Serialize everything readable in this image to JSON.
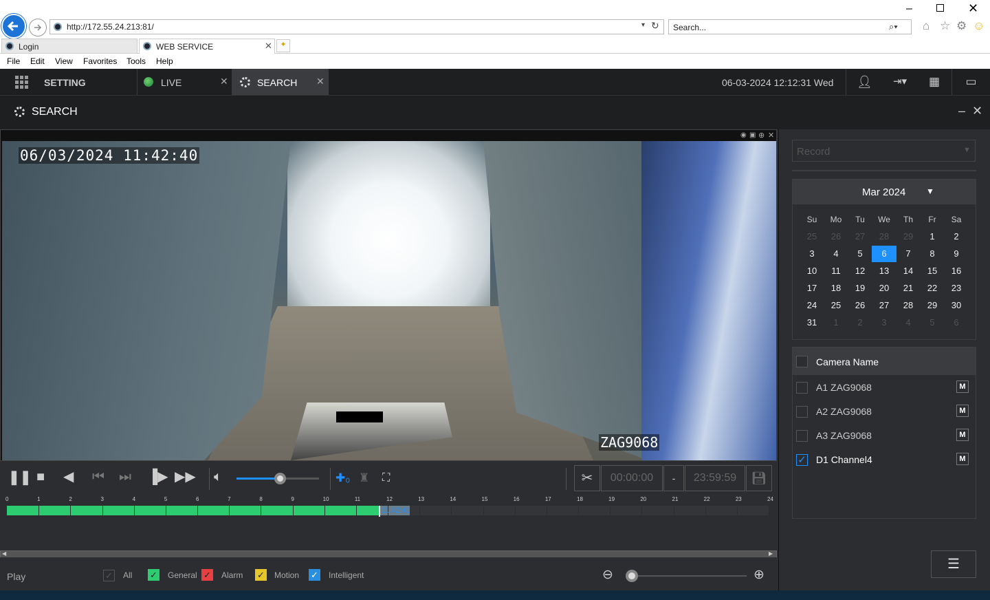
{
  "browser": {
    "address": "http://172.55.24.213:81/",
    "search_placeholder": "Search...",
    "tabs": [
      {
        "label": "Login"
      },
      {
        "label": "WEB SERVICE"
      }
    ],
    "menu": [
      "File",
      "Edit",
      "View",
      "Favorites",
      "Tools",
      "Help"
    ]
  },
  "nav": {
    "setting": "SETTING",
    "live": "LIVE",
    "search": "SEARCH",
    "datetime": "06-03-2024 12:12:31 Wed"
  },
  "page": {
    "title": "SEARCH"
  },
  "video": {
    "osd_timestamp": "06/03/2024 11:42:40",
    "osd_channel": "ZAG9068"
  },
  "clip": {
    "start": "00:00:00",
    "separator": "-",
    "end": "23:59:59"
  },
  "timeline": {
    "hours": [
      "0",
      "1",
      "2",
      "3",
      "4",
      "5",
      "6",
      "7",
      "8",
      "9",
      "10",
      "11",
      "12",
      "13",
      "14",
      "15",
      "16",
      "17",
      "18",
      "19",
      "20",
      "21",
      "22",
      "23",
      "24"
    ],
    "cursor_time": "11:42:41",
    "recorded_until_hour": 12.7
  },
  "bottom": {
    "play_label": "Play",
    "filters": [
      {
        "label": "All",
        "color": "#3a3c40"
      },
      {
        "label": "General",
        "color": "#2ecc71"
      },
      {
        "label": "Alarm",
        "color": "#e84040"
      },
      {
        "label": "Motion",
        "color": "#e6c629"
      },
      {
        "label": "Intelligent",
        "color": "#2b8fe0"
      }
    ]
  },
  "record_select": {
    "value": "Record"
  },
  "calendar": {
    "month_label": "Mar 2024",
    "weekdays": [
      "Su",
      "Mo",
      "Tu",
      "We",
      "Th",
      "Fr",
      "Sa"
    ],
    "weeks": [
      [
        "25",
        "26",
        "27",
        "28",
        "29",
        "1",
        "2"
      ],
      [
        "3",
        "4",
        "5",
        "6",
        "7",
        "8",
        "9"
      ],
      [
        "10",
        "11",
        "12",
        "13",
        "14",
        "15",
        "16"
      ],
      [
        "17",
        "18",
        "19",
        "20",
        "21",
        "22",
        "23"
      ],
      [
        "24",
        "25",
        "26",
        "27",
        "28",
        "29",
        "30"
      ],
      [
        "31",
        "1",
        "2",
        "3",
        "4",
        "5",
        "6"
      ]
    ],
    "selected": "6",
    "recorded_days": [
      "1",
      "2",
      "3",
      "4",
      "5",
      "6"
    ]
  },
  "cameras": {
    "header": "Camera Name",
    "items": [
      {
        "name": "A1 ZAG9068",
        "checked": false,
        "mode": "M"
      },
      {
        "name": "A2 ZAG9068",
        "checked": false,
        "mode": "M"
      },
      {
        "name": "A3 ZAG9068",
        "checked": false,
        "mode": "M"
      },
      {
        "name": "D1 Channel4",
        "checked": true,
        "mode": "M"
      }
    ]
  },
  "colors": {
    "accent": "#1e90ff",
    "recorded": "#2ecc71"
  }
}
